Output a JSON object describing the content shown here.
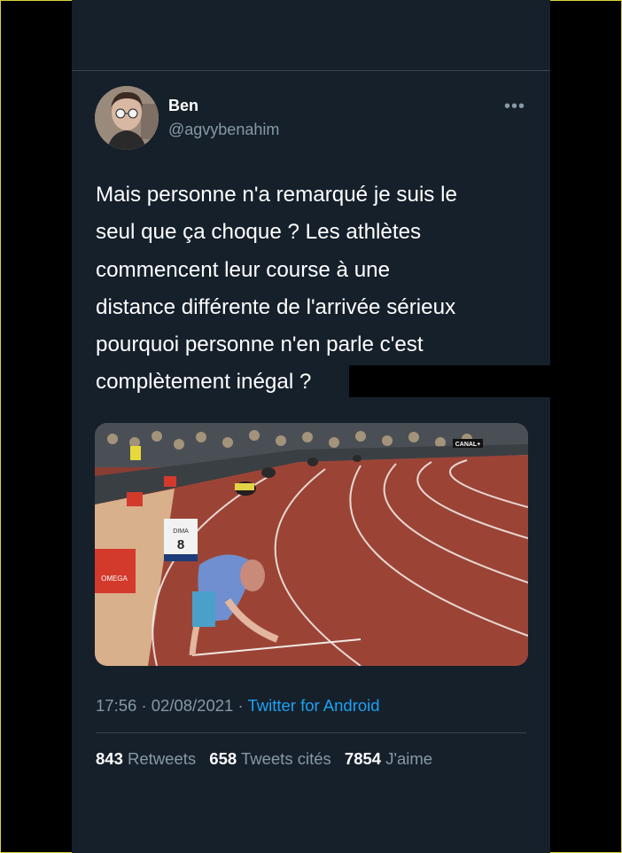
{
  "author": {
    "name": "Ben",
    "handle": "@agvybenahim"
  },
  "tweet": {
    "text": "Mais personne n'a remarqué je suis le\nseul que ça choque ? Les athlètes\ncommencent leur course à une\ndistance différente de l'arrivée sérieux\npourquoi personne n'en parle c'est\ncomplètement inégal ?"
  },
  "media": {
    "overlay_labels": {
      "broadcaster": "CANAL+",
      "sponsor": "OMEGA",
      "block_name": "DIMA",
      "lane_number": "8"
    }
  },
  "meta": {
    "time": "17:56",
    "separator": "·",
    "date": "02/08/2021",
    "source": "Twitter for Android"
  },
  "stats": {
    "retweets_count": "843",
    "retweets_label": "Retweets",
    "quotes_count": "658",
    "quotes_label": "Tweets cités",
    "likes_count": "7854",
    "likes_label": "J'aime"
  },
  "icons": {
    "more": "more-options-icon"
  },
  "colors": {
    "background": "#15202b",
    "text": "#ffffff",
    "secondary": "#8899a6",
    "link": "#1da1f2",
    "track": "#9b4436"
  }
}
